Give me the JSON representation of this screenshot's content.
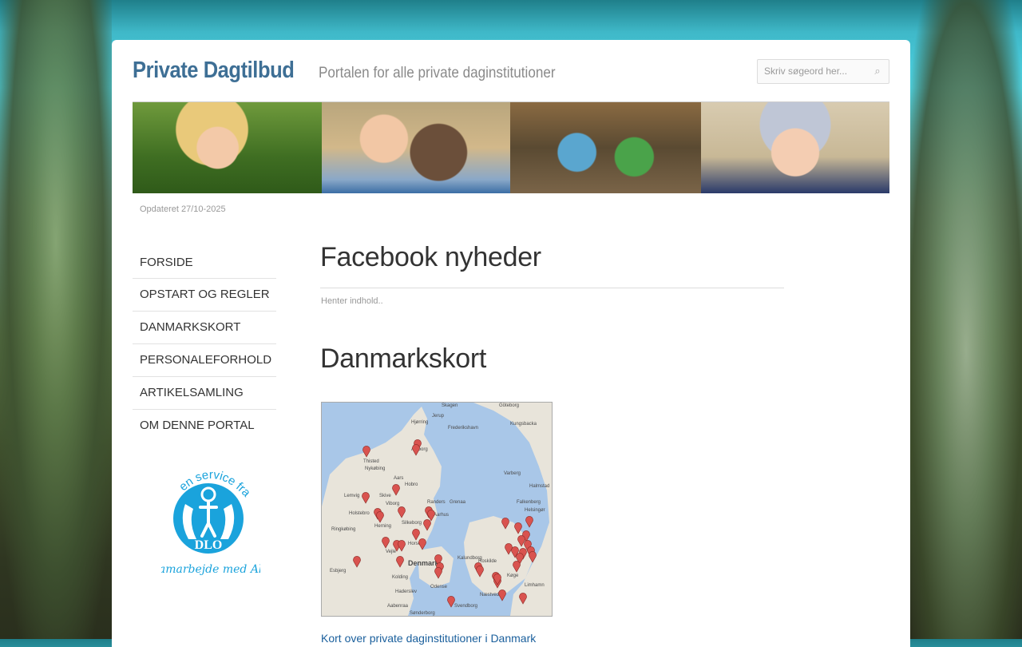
{
  "header": {
    "logo_text": "Private Dagtilbud",
    "tagline": "Portalen for alle private daginstitutioner"
  },
  "search": {
    "placeholder": "Skriv søgeord her...",
    "icon": "search-icon"
  },
  "updated_text": "Opdateret 27/10-2025",
  "nav": {
    "items": [
      {
        "label": "FORSIDE"
      },
      {
        "label": "OPSTART OG REGLER"
      },
      {
        "label": "DANMARKSKORT"
      },
      {
        "label": "PERSONALEFORHOLD"
      },
      {
        "label": "ARTIKELSAMLING"
      },
      {
        "label": "OM DENNE PORTAL"
      }
    ]
  },
  "dlo_logo": {
    "top_text": "en service fra",
    "brand": "DLO",
    "bottom_text": "i samarbejde med Alia",
    "color": "#1aa3dc"
  },
  "facebook": {
    "heading": "Facebook nyheder",
    "status": "Henter indhold.."
  },
  "map_section": {
    "heading": "Danmarkskort",
    "link_text": "Kort over private daginstitutioner i Danmark",
    "marker_color": "#d9534f",
    "labels": [
      "Jerup",
      "Hjørring",
      "Frederikshavn",
      "Aalborg",
      "Thisted",
      "Aars",
      "Hobro",
      "Viborg",
      "Randers",
      "Grenaa",
      "Aarhus",
      "Silkeborg",
      "Herning",
      "Horsens",
      "Vejle",
      "Denmark",
      "Kolding",
      "Esbjerg",
      "Odense",
      "Haderslev",
      "Roskilde",
      "Næstved",
      "Helsingør",
      "Limhamn",
      "Køge",
      "Varberg",
      "Falkenberg",
      "Halmstad",
      "Kungsbacka",
      "Göteborg",
      "Svendborg",
      "Aabenraa",
      "Sønderborg",
      "Holstebro",
      "Skive",
      "Nykøbing",
      "Lemvig",
      "Ringkøbing",
      "Kalundborg",
      "Skagen"
    ]
  }
}
